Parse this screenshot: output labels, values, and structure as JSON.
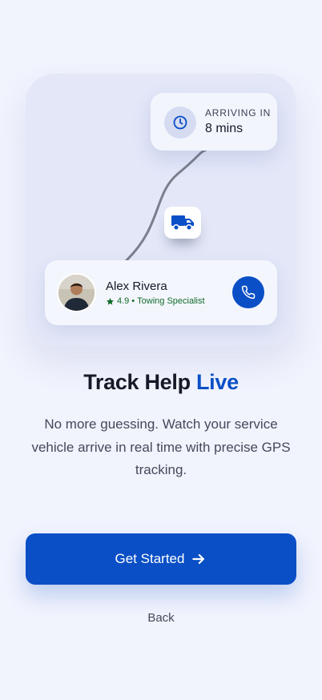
{
  "tracking_card": {
    "eta_label": "ARRIVING IN",
    "eta_value": "8 mins",
    "eta_icon": "clock-icon",
    "vehicle_icon": "truck-icon"
  },
  "driver": {
    "name": "Alex Rivera",
    "rating": "4.9",
    "separator": "•",
    "role": "Towing Specialist",
    "rating_icon": "star-icon",
    "call_icon": "phone-icon"
  },
  "headline": {
    "prefix": "Track Help",
    "accent": "Live"
  },
  "description": "No more guessing. Watch your service vehicle arrive in real time with precise GPS tracking.",
  "actions": {
    "primary_label": "Get Started",
    "primary_icon": "arrow-right-icon",
    "secondary_label": "Back"
  },
  "colors": {
    "background": "#f1f3fd",
    "accent": "#0a4fc6",
    "rating_green": "#0f6b2a"
  }
}
